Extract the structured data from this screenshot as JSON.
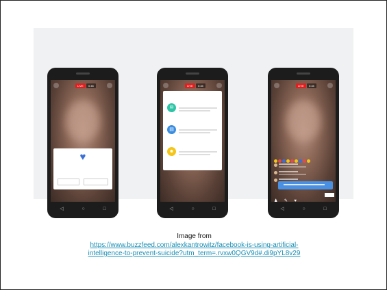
{
  "caption": {
    "label": "Image from",
    "link_line1": "https://www.buzzfeed.com/alexkantrowitz/facebook-is-using-artificial-",
    "link_line2": "intelligence-to-prevent-suicide?utm_term=.rvxw0QGV9d#.di9pYL8v29"
  },
  "phones": [
    {
      "live": "LIVE",
      "viewers": "0:45"
    },
    {
      "live": "LIVE",
      "viewers": "0:45",
      "options": [
        {
          "color": "#2ec4a6",
          "icon": "chat-icon"
        },
        {
          "color": "#3b8de0",
          "icon": "book-icon"
        },
        {
          "color": "#f5c518",
          "icon": "people-icon"
        }
      ]
    },
    {
      "live": "LIVE",
      "viewers": "0:45",
      "reaction_colors": [
        "#f5c518",
        "#e24b4b",
        "#3b6fd8",
        "#f5c518",
        "#e24b4b",
        "#f5c518",
        "#3b6fd8",
        "#e24b4b",
        "#f5c518"
      ]
    }
  ],
  "colors": {
    "live_red": "#e02020",
    "link": "#1a8fb5",
    "facebook_blue": "#4a90e2"
  }
}
